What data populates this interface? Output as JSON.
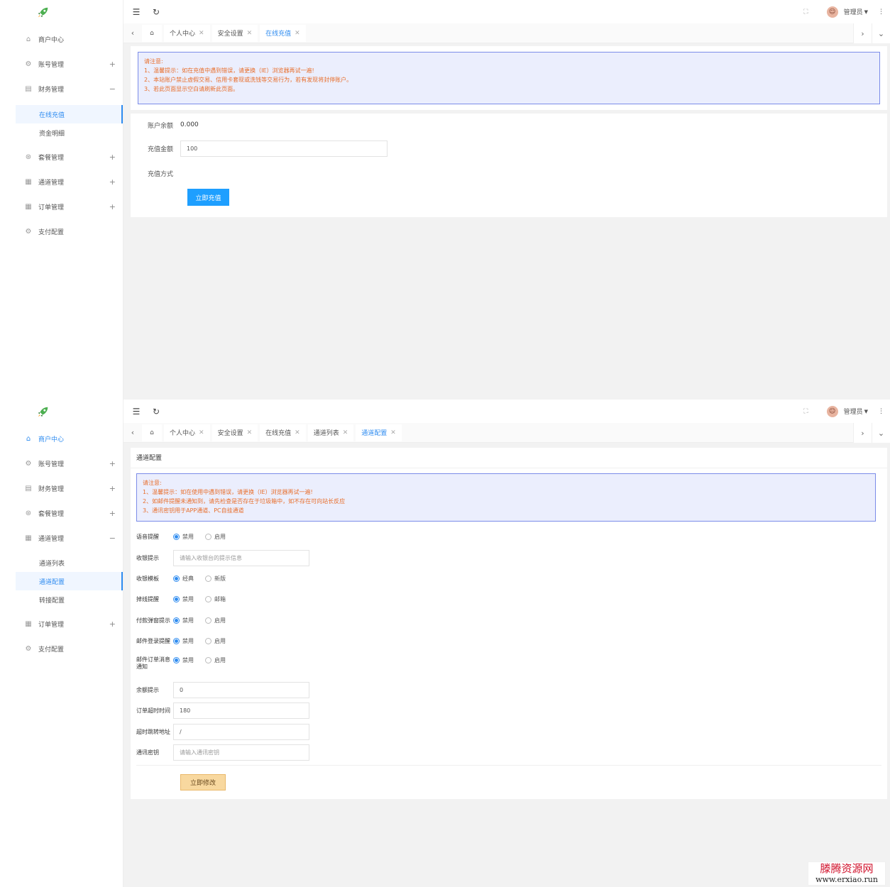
{
  "brand": {
    "accent": "#2f8cf0",
    "primary_button": "#1e9fff",
    "warm_button": "#f8d89f",
    "notice_text": "#e86e2b"
  },
  "shared": {
    "user": "管理员",
    "icons": {
      "menu": "menu-fold-icon",
      "refresh": "refresh-icon",
      "fullscreen": "fullscreen-icon",
      "more": "more-vertical-icon",
      "home": "home-icon"
    }
  },
  "screen1": {
    "sidebar": {
      "items": [
        {
          "label": "商户中心",
          "icon": "home-icon"
        },
        {
          "label": "账号管理",
          "icon": "gear-icon",
          "toggle": "+"
        },
        {
          "label": "财务管理",
          "icon": "finance-icon",
          "toggle": "−"
        },
        {
          "label": "套餐管理",
          "icon": "package-icon",
          "toggle": "+"
        },
        {
          "label": "通道管理",
          "icon": "channel-icon",
          "toggle": "+"
        },
        {
          "label": "订单管理",
          "icon": "order-icon",
          "toggle": "+"
        },
        {
          "label": "支付配置",
          "icon": "settings-icon"
        }
      ],
      "sub_finance": [
        "在线充值",
        "资金明细"
      ]
    },
    "tabs": [
      "个人中心",
      "安全设置",
      "在线充值"
    ],
    "notice": [
      "请注意:",
      "1、温馨提示：如在充值中遇到错误，请更换（IE）浏览器再试一遍!",
      "2、本站账户禁止虚假交易、信用卡套现或洗钱等交易行为，若有发现将封停账户。",
      "3、若此页面显示空白请刷新此页面。"
    ],
    "form": {
      "balance_label": "账户余额",
      "balance_value": "0.000",
      "amount_label": "充值金额",
      "amount_value": "100",
      "method_label": "充值方式",
      "submit": "立即充值"
    }
  },
  "screen2": {
    "sidebar": {
      "items": [
        {
          "label": "商户中心",
          "icon": "home-icon"
        },
        {
          "label": "账号管理",
          "icon": "gear-icon",
          "toggle": "+"
        },
        {
          "label": "财务管理",
          "icon": "finance-icon",
          "toggle": "+"
        },
        {
          "label": "套餐管理",
          "icon": "package-icon",
          "toggle": "+"
        },
        {
          "label": "通道管理",
          "icon": "channel-icon",
          "toggle": "−"
        },
        {
          "label": "订单管理",
          "icon": "order-icon",
          "toggle": "+"
        },
        {
          "label": "支付配置",
          "icon": "settings-icon"
        }
      ],
      "sub_channel": [
        "通道列表",
        "通道配置",
        "转接配置"
      ]
    },
    "tabs": [
      "个人中心",
      "安全设置",
      "在线充值",
      "通道列表",
      "通道配置"
    ],
    "card_title": "通道配置",
    "notice": [
      "请注意:",
      "1、温馨提示：如在使用中遇到错误，请更换（IE）浏览器再试一遍!",
      "2、如邮件提醒未通知到，请先检查是否存在于垃圾箱中，如不存在可向站长反应",
      "3、通讯密钥用于APP通道、PC自挂通道"
    ],
    "form": {
      "voice_label": "语音提醒",
      "voice_opts": [
        "禁用",
        "启用"
      ],
      "cashier_tip_label": "收银提示",
      "cashier_tip_placeholder": "请输入收银台的提示信息",
      "template_label": "收银模板",
      "template_opts": [
        "经典",
        "新版"
      ],
      "offline_label": "掉线提醒",
      "offline_opts": [
        "禁用",
        "邮箱"
      ],
      "popup_label": "付款弹窗提示",
      "popup_opts": [
        "禁用",
        "启用"
      ],
      "mail_login_label": "邮件登录提醒",
      "mail_login_opts": [
        "禁用",
        "启用"
      ],
      "mail_order_label": "邮件订单消息通知",
      "mail_order_opts": [
        "禁用",
        "启用"
      ],
      "balance_tip_label": "余额提示",
      "balance_tip_value": "0",
      "timeout_label": "订单超时时间",
      "timeout_value": "180",
      "redirect_label": "超时跳转地址",
      "redirect_value": "/",
      "secret_label": "通讯密钥",
      "secret_placeholder": "请输入通讯密钥",
      "submit": "立即修改"
    }
  },
  "watermark": {
    "line1": "滕腾资源网",
    "line2": "www.erxiao.run"
  }
}
